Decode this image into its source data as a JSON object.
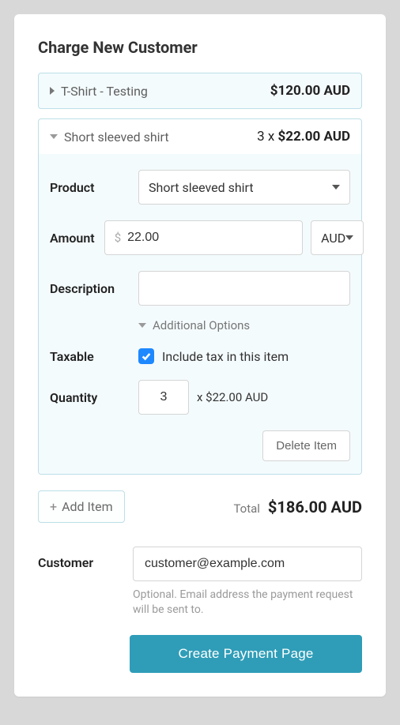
{
  "title": "Charge New Customer",
  "items": [
    {
      "name": "T-Shirt - Testing",
      "summary_price": "$120.00 AUD",
      "expanded": false
    },
    {
      "name": "Short sleeved shirt",
      "summary_qty_prefix": "3 x ",
      "summary_price": "$22.00 AUD",
      "expanded": true,
      "form": {
        "labels": {
          "product": "Product",
          "amount": "Amount",
          "description": "Description",
          "additional_options": "Additional Options",
          "taxable": "Taxable",
          "taxable_text": "Include tax in this item",
          "quantity": "Quantity"
        },
        "product_value": "Short sleeved shirt",
        "amount_value": "22.00",
        "currency_value": "AUD",
        "description_value": "",
        "taxable_checked": true,
        "quantity_value": "3",
        "quantity_suffix": "x $22.00 AUD",
        "delete_label": "Delete Item"
      }
    }
  ],
  "add_item_label": "Add Item",
  "total_label": "Total",
  "total_value": "$186.00 AUD",
  "customer": {
    "label": "Customer",
    "value": "customer@example.com",
    "hint": "Optional. Email address the payment request will be sent to."
  },
  "submit_label": "Create Payment Page"
}
